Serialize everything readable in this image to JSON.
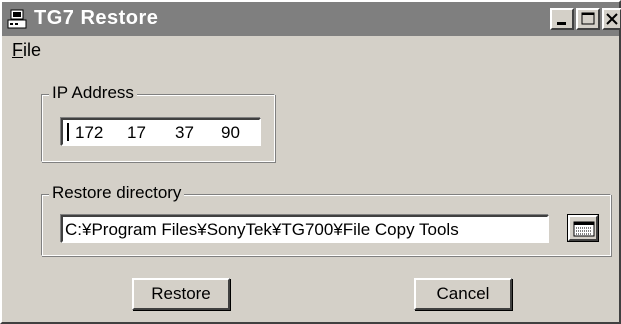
{
  "window": {
    "title": "TG7 Restore",
    "app_icon": "computer-icon"
  },
  "title_buttons": {
    "minimize_icon": "minimize-icon",
    "maximize_icon": "maximize-icon",
    "close_icon": "close-icon"
  },
  "menu": {
    "file_mnemonic": "F",
    "file_rest": "ile"
  },
  "ip_group": {
    "label": "IP Address",
    "octets": [
      "172",
      "17",
      "37",
      "90"
    ]
  },
  "dir_group": {
    "label": "Restore directory",
    "path": "C:¥Program Files¥SonyTek¥TG700¥File Copy Tools",
    "browse_icon": "browse-icon"
  },
  "buttons": {
    "restore": "Restore",
    "cancel": "Cancel"
  },
  "colors": {
    "titlebar": "#7f7f7f",
    "face": "#d4d0c8"
  }
}
